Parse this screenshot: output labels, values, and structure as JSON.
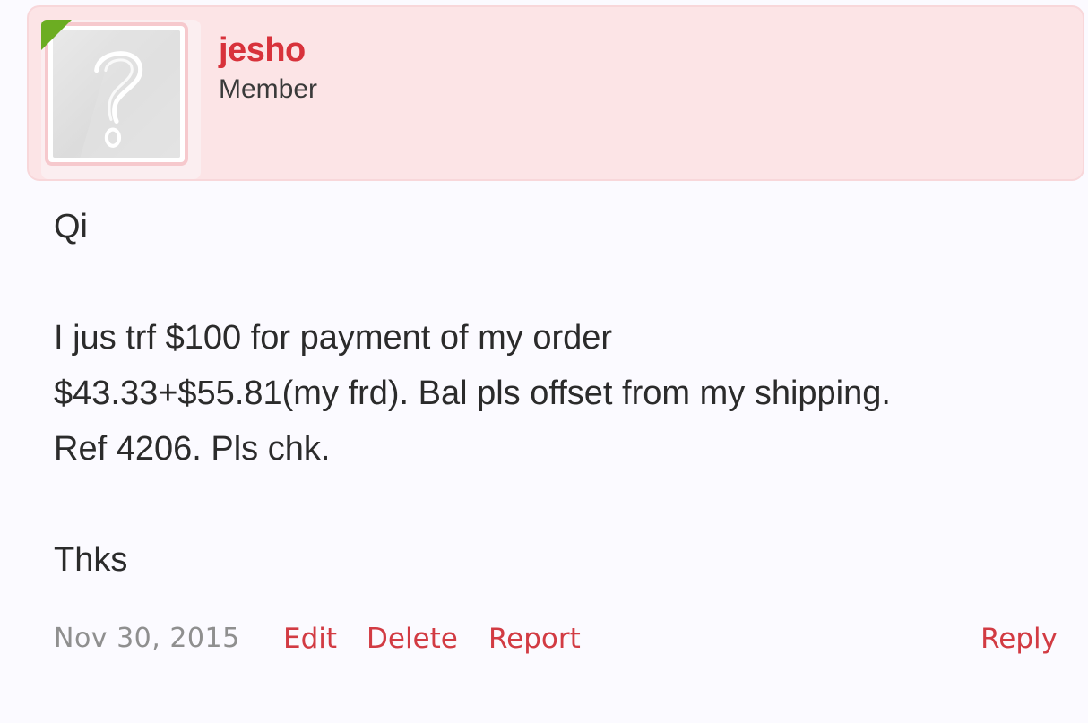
{
  "post": {
    "author": {
      "username": "jesho",
      "title": "Member",
      "avatar_icon": "question-mark-placeholder-icon",
      "online_indicator_color": "#6cad22"
    },
    "message": {
      "greeting": "Qi",
      "line1": "I jus trf $100 for payment of my order",
      "line2": "$43.33+$55.81(my frd). Bal pls offset from my shipping.",
      "line3": "Ref 4206. Pls chk.",
      "signoff": "Thks"
    },
    "footer": {
      "date": "Nov 30, 2015",
      "edit_label": "Edit",
      "delete_label": "Delete",
      "report_label": "Report",
      "reply_label": "Reply"
    }
  },
  "colors": {
    "accent": "#d8323b",
    "header_background": "#fce4e6",
    "page_background": "#fbfaff"
  }
}
